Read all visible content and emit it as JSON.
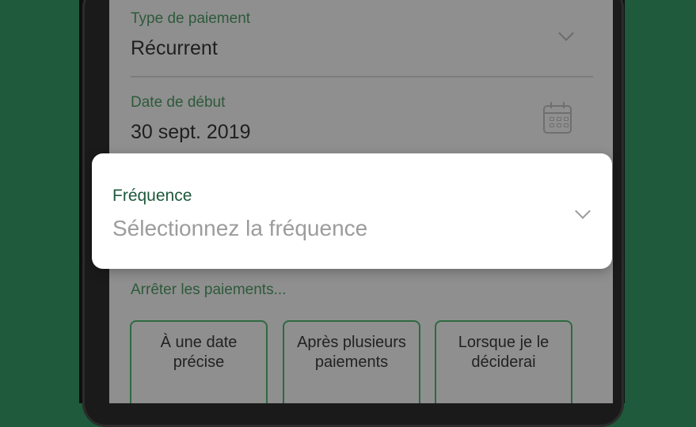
{
  "form": {
    "payment_type": {
      "label": "Type de paiement",
      "value": "Récurrent"
    },
    "start_date": {
      "label": "Date de début",
      "value": "30 sept. 2019"
    },
    "stop_payments": {
      "label": "Arrêter les paiements...",
      "options": [
        "À une date précise",
        "Après plusieurs paiements",
        "Lorsque je le déciderai"
      ]
    }
  },
  "frequency_card": {
    "label": "Fréquence",
    "placeholder": "Sélectionnez la fréquence"
  },
  "colors": {
    "background": "#1e5a3b",
    "accent": "#1e5a3b",
    "card": "#ffffff",
    "dimmed_screen": "#8f8f8f"
  },
  "icons": [
    "chevron-down-icon",
    "calendar-icon"
  ]
}
